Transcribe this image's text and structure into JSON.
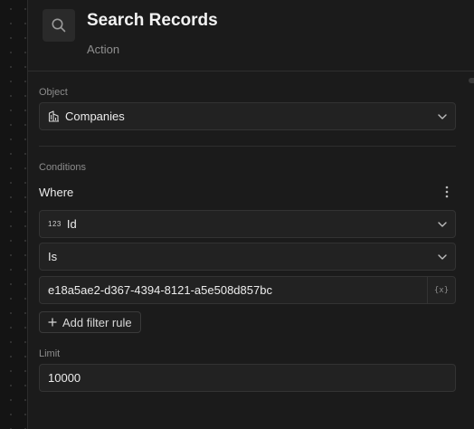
{
  "header": {
    "title": "Search Records",
    "subtitle": "Action",
    "icon": "search-icon"
  },
  "object_section": {
    "label": "Object",
    "selected_value": "Companies",
    "icon": "building-icon"
  },
  "conditions_section": {
    "label": "Conditions",
    "where_label": "Where",
    "field_selected": "Id",
    "field_type_glyph": "123",
    "operator_selected": "Is",
    "value_input": "e18a5ae2-d367-4394-8121-a5e508d857bc",
    "variable_button_glyph": "{x}",
    "add_rule_label": "Add filter rule"
  },
  "limit_section": {
    "label": "Limit",
    "value": "10000"
  },
  "colors": {
    "background": "#1b1b1b",
    "field_bg": "#222222",
    "border": "#333333",
    "text": "#ececec",
    "muted_text": "#8c8c8c"
  }
}
